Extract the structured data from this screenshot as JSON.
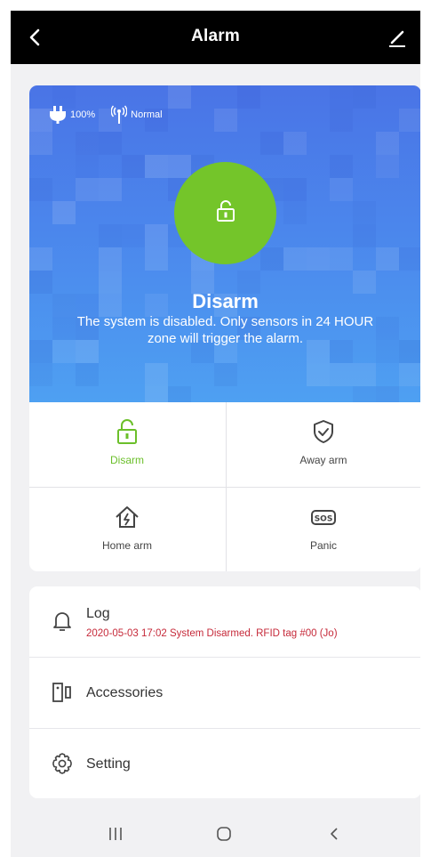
{
  "header": {
    "title": "Alarm",
    "back_icon": "chevron-left-icon",
    "edit_icon": "pencil-icon"
  },
  "status": {
    "power_icon": "plug-icon",
    "battery": "100%",
    "signal_icon": "antenna-icon",
    "signal": "Normal"
  },
  "hero": {
    "lock_icon": "unlock-icon",
    "mode": "Disarm",
    "description": "The system is disabled. Only sensors in 24 HOUR zone will trigger the alarm."
  },
  "modes": [
    {
      "label": "Disarm",
      "icon": "unlock-icon",
      "active": true
    },
    {
      "label": "Away arm",
      "icon": "shield-check-icon",
      "active": false
    },
    {
      "label": "Home arm",
      "icon": "home-lightning-icon",
      "active": false
    },
    {
      "label": "Panic",
      "icon": "sos-icon",
      "active": false
    }
  ],
  "menu": {
    "log": {
      "label": "Log",
      "subtitle": "2020-05-03 17:02 System Disarmed.  RFID tag #00 (Jo)",
      "icon": "bell-icon"
    },
    "accessories": {
      "label": "Accessories",
      "icon": "door-sensor-icon"
    },
    "setting": {
      "label": "Setting",
      "icon": "gear-icon"
    }
  },
  "navigation": {
    "recents_icon": "recents-icon",
    "home_icon": "home-circle-icon",
    "back_icon": "back-icon"
  },
  "colors": {
    "accent_green": "#74c52a",
    "hero_blue": "#4b86ec",
    "log_red": "#c62a3a"
  }
}
